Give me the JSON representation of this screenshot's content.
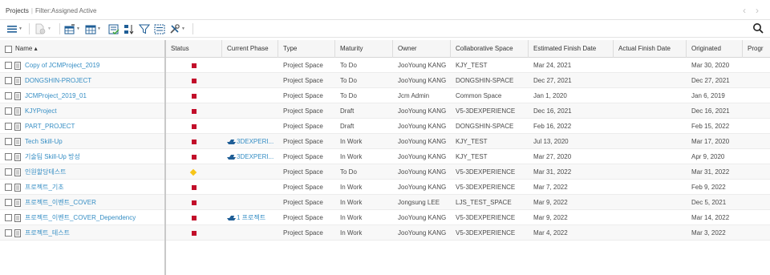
{
  "header": {
    "title": "Projects",
    "filter": "Filter:Assigned Active",
    "prev_glyph": "‹",
    "next_glyph": "›"
  },
  "toolbar": {
    "icons": [
      "menu-icon",
      "new-document-icon",
      "edit-table-icon",
      "table-view-icon",
      "checklist-icon",
      "sort-icon",
      "filter-icon",
      "select-all-icon",
      "tools-icon",
      "search-icon"
    ]
  },
  "columns": {
    "name": "Name ▴",
    "status": "Status",
    "phase": "Current Phase",
    "type": "Type",
    "maturity": "Maturity",
    "owner": "Owner",
    "space": "Collaborative Space",
    "est": "Estimated Finish Date",
    "act": "Actual Finish Date",
    "orig": "Originated",
    "prog": "Progr"
  },
  "rows": [
    {
      "name": "Copy of JCMProject_2019",
      "status": "red",
      "phase": "",
      "type": "Project Space",
      "maturity": "To Do",
      "owner": "JooYoung KANG",
      "space": "KJY_TEST",
      "est": "Mar 24, 2021",
      "act": "",
      "orig": "Mar 30, 2020"
    },
    {
      "name": "DONGSHIN-PROJECT",
      "status": "red",
      "phase": "",
      "type": "Project Space",
      "maturity": "To Do",
      "owner": "JooYoung KANG",
      "space": "DONGSHIN-SPACE",
      "est": "Dec 27, 2021",
      "act": "",
      "orig": "Dec 27, 2021"
    },
    {
      "name": "JCMProject_2019_01",
      "status": "red",
      "phase": "",
      "type": "Project Space",
      "maturity": "To Do",
      "owner": "Jcm Admin",
      "space": "Common Space",
      "est": "Jan 1, 2020",
      "act": "",
      "orig": "Jan 6, 2019"
    },
    {
      "name": "KJYProject",
      "status": "red",
      "phase": "",
      "type": "Project Space",
      "maturity": "Draft",
      "owner": "JooYoung KANG",
      "space": "V5-3DEXPERIENCE",
      "est": "Dec 16, 2021",
      "act": "",
      "orig": "Dec 16, 2021"
    },
    {
      "name": "PART_PROJECT",
      "status": "red",
      "phase": "",
      "type": "Project Space",
      "maturity": "Draft",
      "owner": "JooYoung KANG",
      "space": "DONGSHIN-SPACE",
      "est": "Feb 16, 2022",
      "act": "",
      "orig": "Feb 15, 2022"
    },
    {
      "name": "Tech Skill-Up",
      "status": "red",
      "phase": "3DEXPERI...",
      "type": "Project Space",
      "maturity": "In Work",
      "owner": "JooYoung KANG",
      "space": "KJY_TEST",
      "est": "Jul 13, 2020",
      "act": "",
      "orig": "Mar 17, 2020"
    },
    {
      "name": "기술팀 Skill-Up 방성",
      "status": "red",
      "phase": "3DEXPERI...",
      "type": "Project Space",
      "maturity": "In Work",
      "owner": "JooYoung KANG",
      "space": "KJY_TEST",
      "est": "Mar 27, 2020",
      "act": "",
      "orig": "Apr 9, 2020"
    },
    {
      "name": "인원할당테스트",
      "status": "yellow",
      "phase": "",
      "type": "Project Space",
      "maturity": "To Do",
      "owner": "JooYoung KANG",
      "space": "V5-3DEXPERIENCE",
      "est": "Mar 31, 2022",
      "act": "",
      "orig": "Mar 31, 2022"
    },
    {
      "name": "프로젝트_기초",
      "status": "red",
      "phase": "",
      "type": "Project Space",
      "maturity": "In Work",
      "owner": "JooYoung KANG",
      "space": "V5-3DEXPERIENCE",
      "est": "Mar 7, 2022",
      "act": "",
      "orig": "Feb 9, 2022"
    },
    {
      "name": "프로젝트_이벤트_COVER",
      "status": "red",
      "phase": "",
      "type": "Project Space",
      "maturity": "In Work",
      "owner": "Jongsung LEE",
      "space": "LJS_TEST_SPACE",
      "est": "Mar 9, 2022",
      "act": "",
      "orig": "Dec 5, 2021"
    },
    {
      "name": "프로젝트_이벤트_COVER_Dependency",
      "status": "red",
      "phase": "1 프로젝트",
      "type": "Project Space",
      "maturity": "In Work",
      "owner": "JooYoung KANG",
      "space": "V5-3DEXPERIENCE",
      "est": "Mar 9, 2022",
      "act": "",
      "orig": "Mar 14, 2022"
    },
    {
      "name": "프로젝트_테스트",
      "status": "red",
      "phase": "",
      "type": "Project Space",
      "maturity": "In Work",
      "owner": "JooYoung KANG",
      "space": "V5-3DEXPERIENCE",
      "est": "Mar 4, 2022",
      "act": "",
      "orig": "Mar 3, 2022"
    }
  ]
}
